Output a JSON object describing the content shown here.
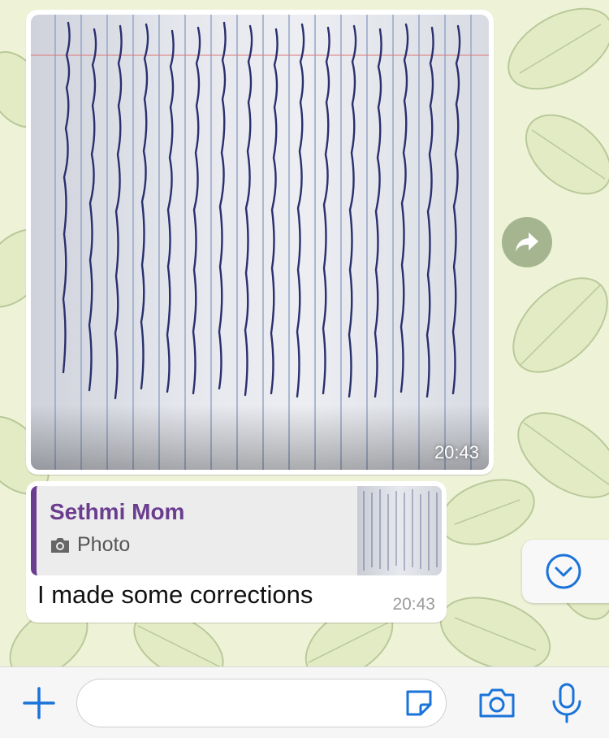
{
  "chat": {
    "image_message": {
      "time": "20:43"
    },
    "reply_message": {
      "quoted_author": "Sethmi Mom",
      "quoted_type_label": "Photo",
      "text": "I made some corrections",
      "time": "20:43"
    }
  },
  "colors": {
    "accent_blue": "#1a73d9",
    "quote_purple": "#6b3d8f",
    "wallpaper": "#eef3d8"
  },
  "icons": {
    "forward": "forward-arrow-icon",
    "scroll_down": "chevron-down-icon",
    "plus": "plus-icon",
    "sticker": "sticker-icon",
    "camera": "camera-icon",
    "mic": "microphone-icon",
    "quote_camera": "camera-icon"
  }
}
